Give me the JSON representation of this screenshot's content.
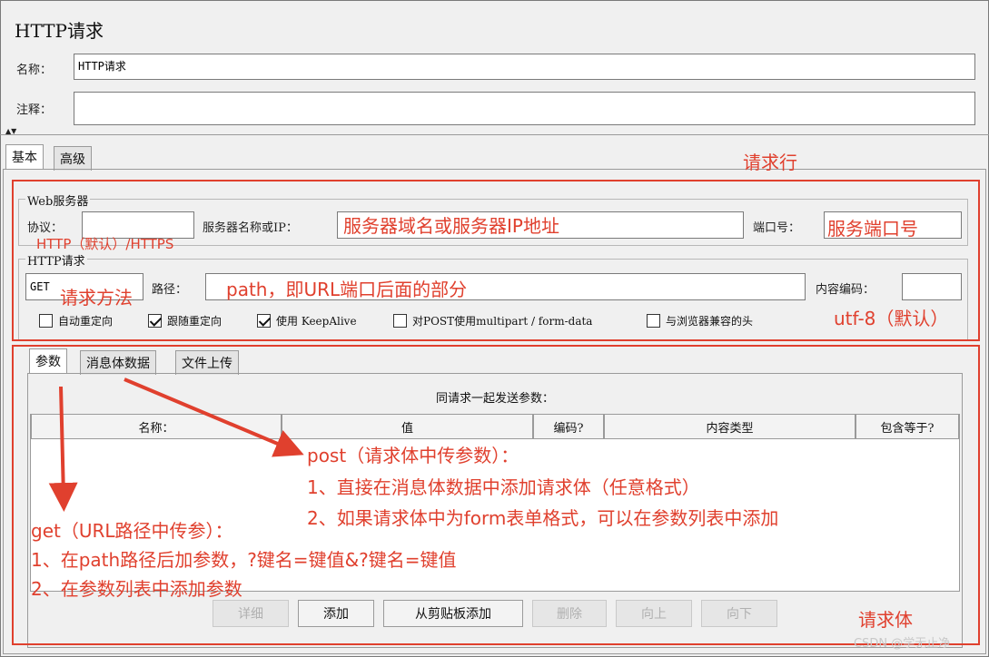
{
  "header": {
    "title": "HTTP请求"
  },
  "name_field": {
    "label": "名称：",
    "value": "HTTP请求"
  },
  "comment_field": {
    "label": "注释：",
    "value": ""
  },
  "main_tabs": [
    {
      "label": "基本",
      "active": true
    },
    {
      "label": "高级",
      "active": false
    }
  ],
  "web_server": {
    "title": "Web服务器",
    "protocol_label": "协议：",
    "protocol_value": "",
    "server_label": "服务器名称或IP：",
    "server_value": "",
    "port_label": "端口号：",
    "port_value": ""
  },
  "http_request": {
    "title": "HTTP请求",
    "method_value": "GET",
    "path_label": "路径：",
    "path_value": "",
    "encoding_label": "内容编码：",
    "encoding_value": ""
  },
  "options": [
    {
      "label": "自动重定向",
      "checked": false
    },
    {
      "label": "跟随重定向",
      "checked": true
    },
    {
      "label": "使用 KeepAlive",
      "checked": true
    },
    {
      "label": "对POST使用multipart / form-data",
      "checked": false
    },
    {
      "label": "与浏览器兼容的头",
      "checked": false
    }
  ],
  "param_tabs": [
    {
      "label": "参数",
      "active": true
    },
    {
      "label": "消息体数据",
      "active": false
    },
    {
      "label": "文件上传",
      "active": false
    }
  ],
  "params_table": {
    "caption": "同请求一起发送参数：",
    "columns": [
      "名称：",
      "值",
      "编码?",
      "内容类型",
      "包含等于?"
    ],
    "rows": []
  },
  "buttons": [
    {
      "label": "详细",
      "enabled": false
    },
    {
      "label": "添加",
      "enabled": true
    },
    {
      "label": "从剪贴板添加",
      "enabled": true
    },
    {
      "label": "删除",
      "enabled": false
    },
    {
      "label": "向上",
      "enabled": false
    },
    {
      "label": "向下",
      "enabled": false
    }
  ],
  "annotations": {
    "request_line": "请求行",
    "server_hint": "服务器域名或服务器IP地址",
    "protocol_hint": "HTTP（默认）/HTTPS",
    "port_hint": "服务端口号",
    "method_hint": "请求方法",
    "path_hint": "path，即URL端口后面的部分",
    "encoding_hint": "utf-8（默认）",
    "post_title": "post（请求体中传参数）：",
    "post_1": "1、直接在消息体数据中添加请求体（任意格式）",
    "post_2": "2、如果请求体中为form表单格式，可以在参数列表中添加",
    "get_title": "get（URL路径中传参）：",
    "get_1": "1、在path路径后加参数，?键名=键值&?键名=键值",
    "get_2": "2、在参数列表中添加参数",
    "request_body": "请求体"
  },
  "watermark": "CSDN @学无止净",
  "colors": {
    "annotation": "#e0402e",
    "panel_bg": "#f0f0f0"
  }
}
